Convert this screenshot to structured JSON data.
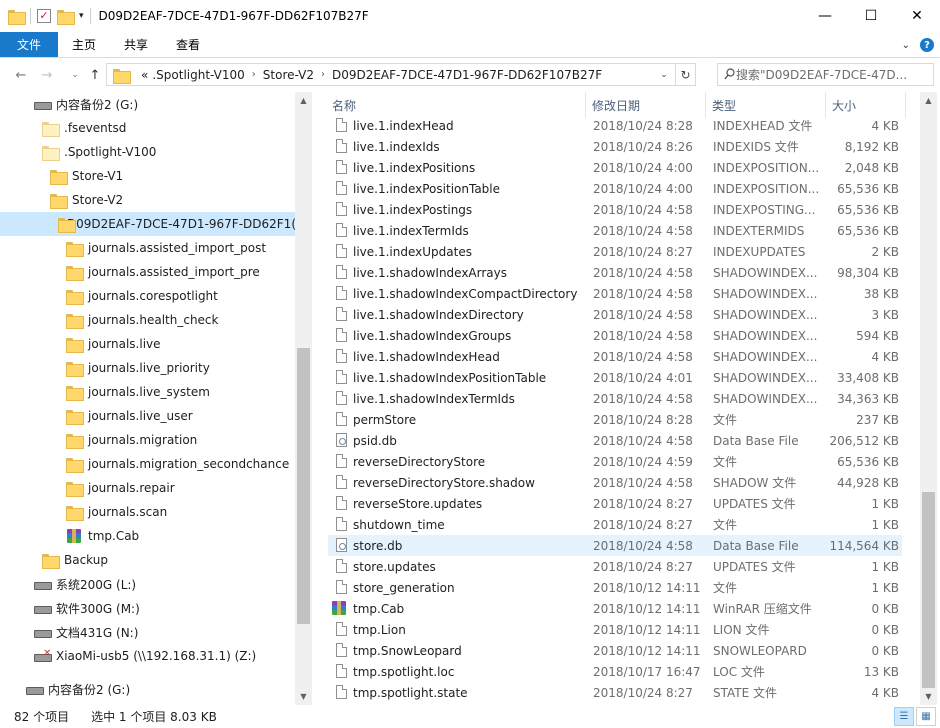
{
  "window": {
    "title": "D09D2EAF-7DCE-47D1-967F-DD62F107B27F",
    "controls": {
      "minimize": "—",
      "maximize": "☐",
      "close": "✕"
    }
  },
  "ribbon": {
    "tabs": [
      {
        "label": "文件",
        "active": true
      },
      {
        "label": "主页"
      },
      {
        "label": "共享"
      },
      {
        "label": "查看"
      }
    ]
  },
  "address": {
    "overflow": "«",
    "crumbs": [
      ".Spotlight-V100",
      "Store-V2",
      "D09D2EAF-7DCE-47D1-967F-DD62F107B27F"
    ]
  },
  "search": {
    "placeholder": "搜索\"D09D2EAF-7DCE-47D..."
  },
  "nav": {
    "items": [
      {
        "label": "内容备份2 (G:)",
        "icon": "drive-icon",
        "indent": 0
      },
      {
        "label": ".fseventsd",
        "icon": "folder-pale-icon",
        "indent": 1
      },
      {
        "label": ".Spotlight-V100",
        "icon": "folder-pale-icon",
        "indent": 1
      },
      {
        "label": "Store-V1",
        "icon": "folder-icon",
        "indent": 2
      },
      {
        "label": "Store-V2",
        "icon": "folder-icon",
        "indent": 2
      },
      {
        "label": "D09D2EAF-7DCE-47D1-967F-DD62F1(",
        "icon": "folder-icon",
        "indent": 3,
        "selected": true
      },
      {
        "label": "journals.assisted_import_post",
        "icon": "folder-icon",
        "indent": 4
      },
      {
        "label": "journals.assisted_import_pre",
        "icon": "folder-icon",
        "indent": 4
      },
      {
        "label": "journals.corespotlight",
        "icon": "folder-icon",
        "indent": 4
      },
      {
        "label": "journals.health_check",
        "icon": "folder-icon",
        "indent": 4
      },
      {
        "label": "journals.live",
        "icon": "folder-icon",
        "indent": 4
      },
      {
        "label": "journals.live_priority",
        "icon": "folder-icon",
        "indent": 4
      },
      {
        "label": "journals.live_system",
        "icon": "folder-icon",
        "indent": 4
      },
      {
        "label": "journals.live_user",
        "icon": "folder-icon",
        "indent": 4
      },
      {
        "label": "journals.migration",
        "icon": "folder-icon",
        "indent": 4
      },
      {
        "label": "journals.migration_secondchance",
        "icon": "folder-icon",
        "indent": 4
      },
      {
        "label": "journals.repair",
        "icon": "folder-icon",
        "indent": 4
      },
      {
        "label": "journals.scan",
        "icon": "folder-icon",
        "indent": 4
      },
      {
        "label": "tmp.Cab",
        "icon": "winrar-icon",
        "indent": 4
      },
      {
        "label": "Backup",
        "icon": "folder-icon",
        "indent": 1
      },
      {
        "label": "系统200G (L:)",
        "icon": "drive-icon",
        "indent": 0
      },
      {
        "label": "软件300G (M:)",
        "icon": "drive-icon",
        "indent": 0
      },
      {
        "label": "文档431G (N:)",
        "icon": "drive-icon",
        "indent": 0
      },
      {
        "label": "XiaoMi-usb5 (\\\\192.168.31.1) (Z:)",
        "icon": "network-drive-icon",
        "indent": 0
      },
      {
        "label": "内容备份2 (G:)",
        "icon": "drive-icon",
        "indent": -1
      }
    ]
  },
  "columns": {
    "name": "名称",
    "date": "修改日期",
    "type": "类型",
    "size": "大小"
  },
  "files": [
    {
      "name": "live.1.indexHead",
      "date": "2018/10/24 8:28",
      "type": "INDEXHEAD 文件",
      "size": "4 KB",
      "icon": "file-icon"
    },
    {
      "name": "live.1.indexIds",
      "date": "2018/10/24 8:26",
      "type": "INDEXIDS 文件",
      "size": "8,192 KB",
      "icon": "file-icon"
    },
    {
      "name": "live.1.indexPositions",
      "date": "2018/10/24 4:00",
      "type": "INDEXPOSITION...",
      "size": "2,048 KB",
      "icon": "file-icon"
    },
    {
      "name": "live.1.indexPositionTable",
      "date": "2018/10/24 4:00",
      "type": "INDEXPOSITION...",
      "size": "65,536 KB",
      "icon": "file-icon"
    },
    {
      "name": "live.1.indexPostings",
      "date": "2018/10/24 4:58",
      "type": "INDEXPOSTING...",
      "size": "65,536 KB",
      "icon": "file-icon"
    },
    {
      "name": "live.1.indexTermIds",
      "date": "2018/10/24 4:58",
      "type": "INDEXTERMIDS",
      "size": "65,536 KB",
      "icon": "file-icon"
    },
    {
      "name": "live.1.indexUpdates",
      "date": "2018/10/24 8:27",
      "type": "INDEXUPDATES",
      "size": "2 KB",
      "icon": "file-icon"
    },
    {
      "name": "live.1.shadowIndexArrays",
      "date": "2018/10/24 4:58",
      "type": "SHADOWINDEX...",
      "size": "98,304 KB",
      "icon": "file-icon"
    },
    {
      "name": "live.1.shadowIndexCompactDirectory",
      "date": "2018/10/24 4:58",
      "type": "SHADOWINDEX...",
      "size": "38 KB",
      "icon": "file-icon"
    },
    {
      "name": "live.1.shadowIndexDirectory",
      "date": "2018/10/24 4:58",
      "type": "SHADOWINDEX...",
      "size": "3 KB",
      "icon": "file-icon"
    },
    {
      "name": "live.1.shadowIndexGroups",
      "date": "2018/10/24 4:58",
      "type": "SHADOWINDEX...",
      "size": "594 KB",
      "icon": "file-icon"
    },
    {
      "name": "live.1.shadowIndexHead",
      "date": "2018/10/24 4:58",
      "type": "SHADOWINDEX...",
      "size": "4 KB",
      "icon": "file-icon"
    },
    {
      "name": "live.1.shadowIndexPositionTable",
      "date": "2018/10/24 4:01",
      "type": "SHADOWINDEX...",
      "size": "33,408 KB",
      "icon": "file-icon"
    },
    {
      "name": "live.1.shadowIndexTermIds",
      "date": "2018/10/24 4:58",
      "type": "SHADOWINDEX...",
      "size": "34,363 KB",
      "icon": "file-icon"
    },
    {
      "name": "permStore",
      "date": "2018/10/24 8:28",
      "type": "文件",
      "size": "237 KB",
      "icon": "file-icon"
    },
    {
      "name": "psid.db",
      "date": "2018/10/24 4:58",
      "type": "Data Base File",
      "size": "206,512 KB",
      "icon": "database-icon"
    },
    {
      "name": "reverseDirectoryStore",
      "date": "2018/10/24 4:59",
      "type": "文件",
      "size": "65,536 KB",
      "icon": "file-icon"
    },
    {
      "name": "reverseDirectoryStore.shadow",
      "date": "2018/10/24 4:58",
      "type": "SHADOW 文件",
      "size": "44,928 KB",
      "icon": "file-icon"
    },
    {
      "name": "reverseStore.updates",
      "date": "2018/10/24 8:27",
      "type": "UPDATES 文件",
      "size": "1 KB",
      "icon": "file-icon"
    },
    {
      "name": "shutdown_time",
      "date": "2018/10/24 8:27",
      "type": "文件",
      "size": "1 KB",
      "icon": "file-icon"
    },
    {
      "name": "store.db",
      "date": "2018/10/24 4:58",
      "type": "Data Base File",
      "size": "114,564 KB",
      "icon": "database-icon",
      "selected": true
    },
    {
      "name": "store.updates",
      "date": "2018/10/24 8:27",
      "type": "UPDATES 文件",
      "size": "1 KB",
      "icon": "file-icon"
    },
    {
      "name": "store_generation",
      "date": "2018/10/12 14:11",
      "type": "文件",
      "size": "1 KB",
      "icon": "file-icon"
    },
    {
      "name": "tmp.Cab",
      "date": "2018/10/12 14:11",
      "type": "WinRAR 压缩文件",
      "size": "0 KB",
      "icon": "winrar-icon"
    },
    {
      "name": "tmp.Lion",
      "date": "2018/10/12 14:11",
      "type": "LION 文件",
      "size": "0 KB",
      "icon": "file-icon"
    },
    {
      "name": "tmp.SnowLeopard",
      "date": "2018/10/12 14:11",
      "type": "SNOWLEOPARD",
      "size": "0 KB",
      "icon": "file-icon"
    },
    {
      "name": "tmp.spotlight.loc",
      "date": "2018/10/17 16:47",
      "type": "LOC 文件",
      "size": "13 KB",
      "icon": "file-icon"
    },
    {
      "name": "tmp.spotlight.state",
      "date": "2018/10/24 8:27",
      "type": "STATE 文件",
      "size": "4 KB",
      "icon": "file-icon"
    }
  ],
  "status": {
    "count": "82 个项目",
    "selection": "选中 1 个项目  8.03 KB"
  },
  "colors": {
    "accent": "#1979ca",
    "selection": "#cce8ff",
    "hover": "#e5f3ff"
  }
}
